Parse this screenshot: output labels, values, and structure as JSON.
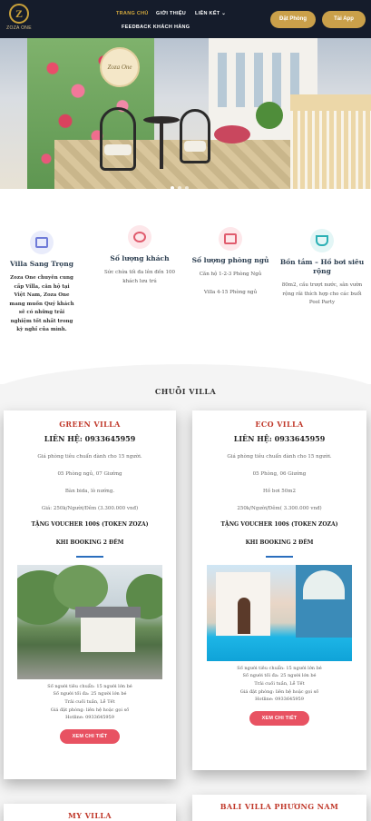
{
  "header": {
    "logo_mark": "Z",
    "logo_text": "ZOZA ONE",
    "nav": [
      {
        "label": "TRANG CHỦ"
      },
      {
        "label": "GIỚI THIỆU"
      },
      {
        "label": "LIÊN KẾT ⌄"
      },
      {
        "label": "FEEDBACK KHÁCH HÀNG"
      }
    ],
    "book_label": "Đặt Phòng",
    "app_label": "Tải App"
  },
  "hero": {
    "sign_text": "Zoza One"
  },
  "features": [
    {
      "icon": "villa-icon",
      "title": "Villa Sang Trọng",
      "text": "Zoza One chuyên cung cấp Villa, căn hộ tại Việt Nam, Zoza One mang muốn Quý khách sẽ có những trải nghiệm tốt nhất trong kỳ nghỉ của mình."
    },
    {
      "icon": "guests-icon",
      "title": "Số lượng khách",
      "text": "Sức chứa tối đa lên đến 100 khách lưu trú"
    },
    {
      "icon": "bed-icon",
      "title": "Số lượng phòng ngủ",
      "text": "Căn hộ 1-2-3 Phòng Ngủ",
      "text2": "Villa 4-15 Phòng ngủ"
    },
    {
      "icon": "bathtub-icon",
      "title": "Bồn tắm – Hồ bơi siêu rộng",
      "text": "80m2, cầu trượt nước, sân vườn rộng rãi thích hợp cho các buổi Pool Party"
    }
  ],
  "section_title": "CHUỖI VILLA",
  "villas": [
    {
      "name": "GREEN VILLA",
      "phone": "LIÊN HỆ: 0933645959",
      "lines": [
        "Giá phòng tiêu chuẩn dành cho 15 người.",
        "05 Phòng ngủ, 07 Giường",
        "Bàn bida, lò nướng.",
        "Giá: 250k/Người/Đêm (3.300.000 vnđ)"
      ],
      "voucher": "TẶNG VOUCHER 100$ (TOKEN ZOZA)",
      "booking": "KHI BOOKING 2 ĐÊM",
      "specs": [
        "Số người tiêu chuẩn: 15 người lớn bé",
        "Số người tối đa: 25 người lớn bé",
        "Trải cuối tuần, Lễ Tết",
        "Giá đặt phòng: liên hệ hoặc gọi số",
        "Hotline: 0933645959"
      ],
      "button": "XEM CHI TIẾT"
    },
    {
      "name": "ECO VILLA",
      "phone": "LIÊN HỆ: 0933645959",
      "lines": [
        "Giá phòng tiêu chuẩn dành cho 15 người.",
        "05 Phòng, 06 Giường",
        "Hồ bơi 50m2",
        "250k/Người/Đêm( 3.300.000 vnđ)"
      ],
      "voucher": "TẶNG VOUCHER 100$ (TOKEN ZOZA)",
      "booking": "KHI BOOKING 2 ĐÊM",
      "specs": [
        "Số người tiêu chuẩn: 15 người lớn bé",
        "Số người tối đa: 25 người lớn bé",
        "Trải cuối tuần, Lễ Tết",
        "Giá đặt phòng: liên hệ hoặc gọi số",
        "Hotline: 0933645959"
      ],
      "button": "XEM CHI TIẾT"
    },
    {
      "name": "MY VILLA"
    },
    {
      "name": "BALI VILLA PHƯƠNG NAM"
    }
  ]
}
